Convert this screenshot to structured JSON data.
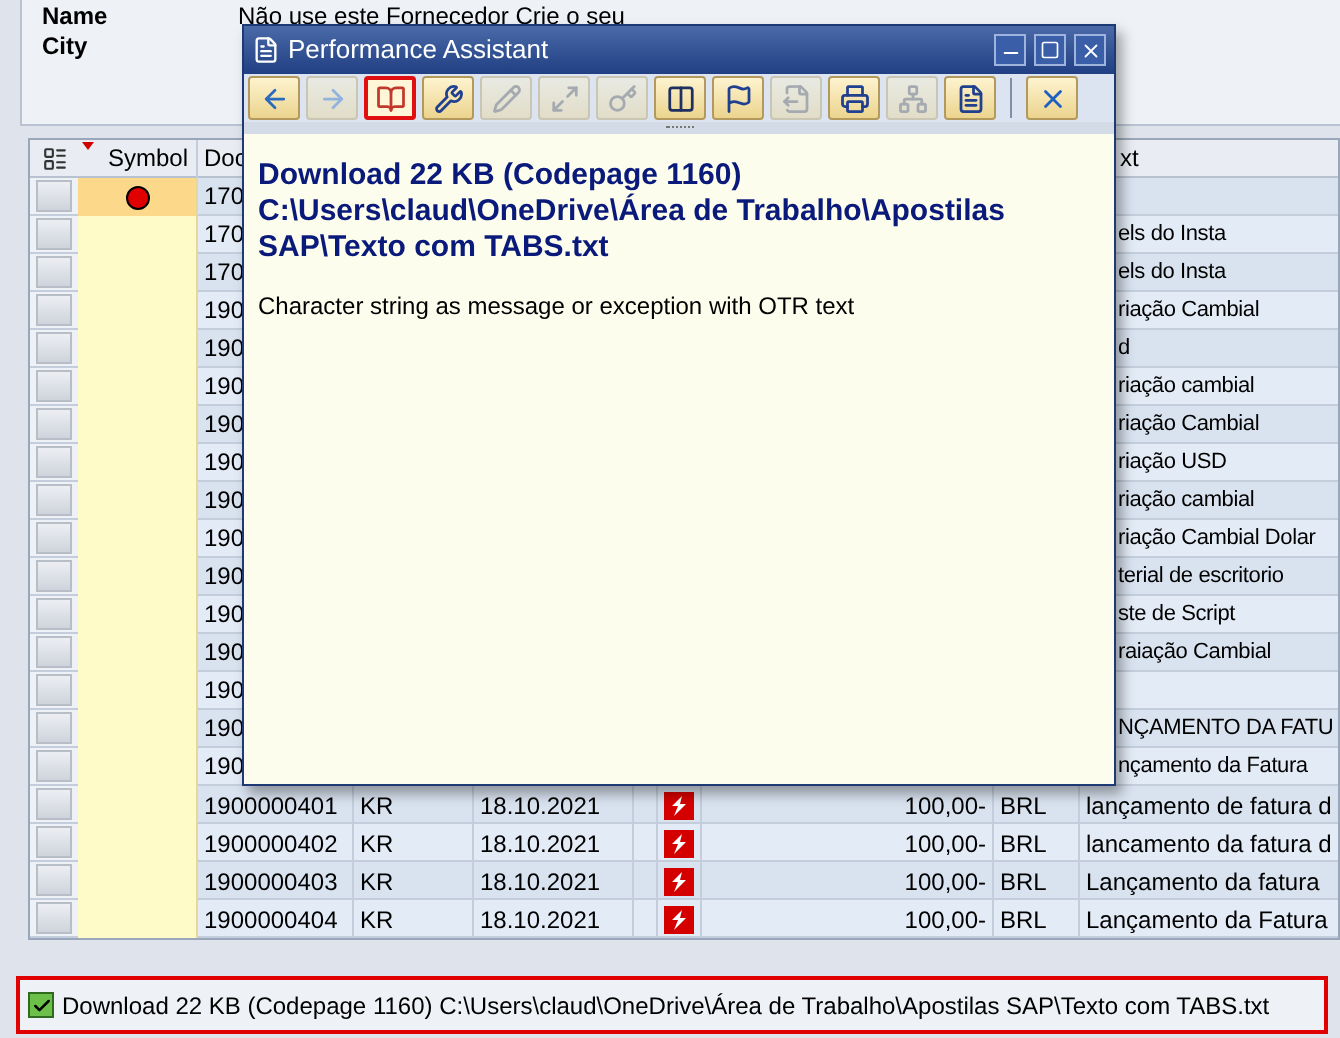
{
  "header": {
    "fields": [
      {
        "label": "Name",
        "value": "Não use este Fornecedor Crie o seu"
      },
      {
        "label": "City"
      }
    ]
  },
  "table": {
    "columns": [
      "Symbol",
      "Doc",
      "xt"
    ],
    "rows": [
      {
        "kind": "covered",
        "flagged": true,
        "doc": "170"
      },
      {
        "kind": "covered",
        "flagged": false,
        "doc": "170",
        "text": "els do Insta"
      },
      {
        "kind": "covered",
        "flagged": false,
        "doc": "170",
        "text": "els do Insta"
      },
      {
        "kind": "covered",
        "flagged": false,
        "doc": "190",
        "text": "riação Cambial"
      },
      {
        "kind": "covered",
        "flagged": false,
        "doc": "190",
        "text": "d"
      },
      {
        "kind": "covered",
        "flagged": false,
        "doc": "190",
        "text": "riação cambial"
      },
      {
        "kind": "covered",
        "flagged": false,
        "doc": "190",
        "text": "riação Cambial"
      },
      {
        "kind": "covered",
        "flagged": false,
        "doc": "190",
        "text": "riação USD"
      },
      {
        "kind": "covered",
        "flagged": false,
        "doc": "190",
        "text": "riação cambial"
      },
      {
        "kind": "covered",
        "flagged": false,
        "doc": "190",
        "text": "riação Cambial Dolar"
      },
      {
        "kind": "covered",
        "flagged": false,
        "doc": "190",
        "text": "terial de escritorio"
      },
      {
        "kind": "covered",
        "flagged": false,
        "doc": "190",
        "text": "ste de Script"
      },
      {
        "kind": "covered",
        "flagged": false,
        "doc": "190",
        "text": "raiação Cambial"
      },
      {
        "kind": "covered",
        "flagged": false,
        "doc": "190"
      },
      {
        "kind": "covered",
        "flagged": false,
        "doc": "190",
        "text": "NÇAMENTO DA FATU"
      },
      {
        "kind": "covered",
        "flagged": false,
        "doc": "190",
        "text": "nçamento da Fatura"
      },
      {
        "kind": "full",
        "flagged": false,
        "doc": "1900000401",
        "type": "KR",
        "date": "18.10.2021",
        "amount": "100,00-",
        "currency": "BRL",
        "text": "lançamento de fatura d"
      },
      {
        "kind": "full",
        "flagged": false,
        "doc": "1900000402",
        "type": "KR",
        "date": "18.10.2021",
        "amount": "100,00-",
        "currency": "BRL",
        "text": "lancamento da fatura d"
      },
      {
        "kind": "full",
        "flagged": false,
        "doc": "1900000403",
        "type": "KR",
        "date": "18.10.2021",
        "amount": "100,00-",
        "currency": "BRL",
        "text": "Lançamento da fatura"
      },
      {
        "kind": "full",
        "flagged": false,
        "doc": "1900000404",
        "type": "KR",
        "date": "18.10.2021",
        "amount": "100,00-",
        "currency": "BRL",
        "text": "Lançamento da Fatura"
      }
    ]
  },
  "popup": {
    "title": "Performance Assistant",
    "toolbar": [
      {
        "kind": "back",
        "disabled": false,
        "selected": false
      },
      {
        "kind": "forward",
        "disabled": true,
        "selected": false
      },
      {
        "kind": "book",
        "disabled": false,
        "selected": true
      },
      {
        "kind": "tools",
        "disabled": false,
        "selected": false
      },
      {
        "kind": "edit",
        "disabled": true,
        "selected": false
      },
      {
        "kind": "expand",
        "disabled": true,
        "selected": false
      },
      {
        "kind": "key",
        "disabled": true,
        "selected": false
      },
      {
        "kind": "columns",
        "disabled": false,
        "selected": false
      },
      {
        "kind": "flag",
        "disabled": false,
        "selected": false
      },
      {
        "kind": "export",
        "disabled": true,
        "selected": false
      },
      {
        "kind": "print",
        "disabled": false,
        "selected": false
      },
      {
        "kind": "tree",
        "disabled": true,
        "selected": false
      },
      {
        "kind": "list",
        "disabled": false,
        "selected": false
      },
      {
        "kind": "close",
        "disabled": false,
        "selected": false
      }
    ],
    "heading": "Download 22 KB (Codepage 1160) C:\\Users\\claud\\OneDrive\\Área de Trabalho\\Apostilas SAP\\Texto com TABS.txt",
    "body": "Character string as message or exception with OTR text"
  },
  "status_bar": {
    "kind": "success",
    "message": "Download 22 KB (Codepage 1160) C:\\Users\\claud\\OneDrive\\Área de Trabalho\\Apostilas SAP\\Texto com TABS.txt"
  }
}
